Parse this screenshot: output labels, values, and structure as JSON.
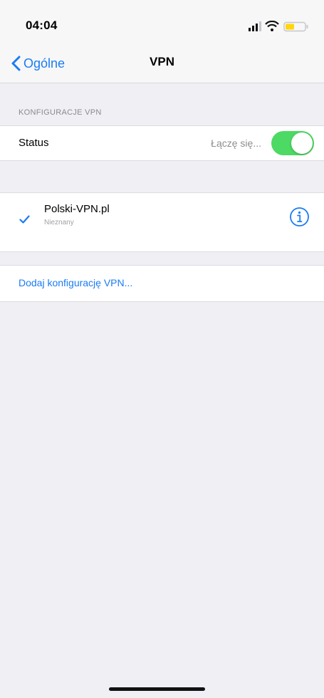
{
  "status_bar": {
    "time": "04:04"
  },
  "nav": {
    "back_label": "Ogólne",
    "title": "VPN"
  },
  "vpn_section": {
    "header": "KONFIGURACJE VPN",
    "status_label": "Status",
    "status_value": "Łączę się...",
    "toggle_on": true
  },
  "configurations": [
    {
      "name": "Polski-VPN.pl",
      "subtitle": "Nieznany",
      "selected": true
    }
  ],
  "actions": {
    "add_vpn": "Dodaj konfigurację VPN..."
  },
  "colors": {
    "accent": "#1a7cf2",
    "toggle_on": "#4cd964",
    "background": "#efeff4",
    "battery": "#ffd60a"
  },
  "icons": {
    "back": "chevron-left-icon",
    "signal": "signal-icon",
    "wifi": "wifi-icon",
    "battery": "battery-icon",
    "check": "checkmark-icon",
    "info": "info-icon"
  }
}
